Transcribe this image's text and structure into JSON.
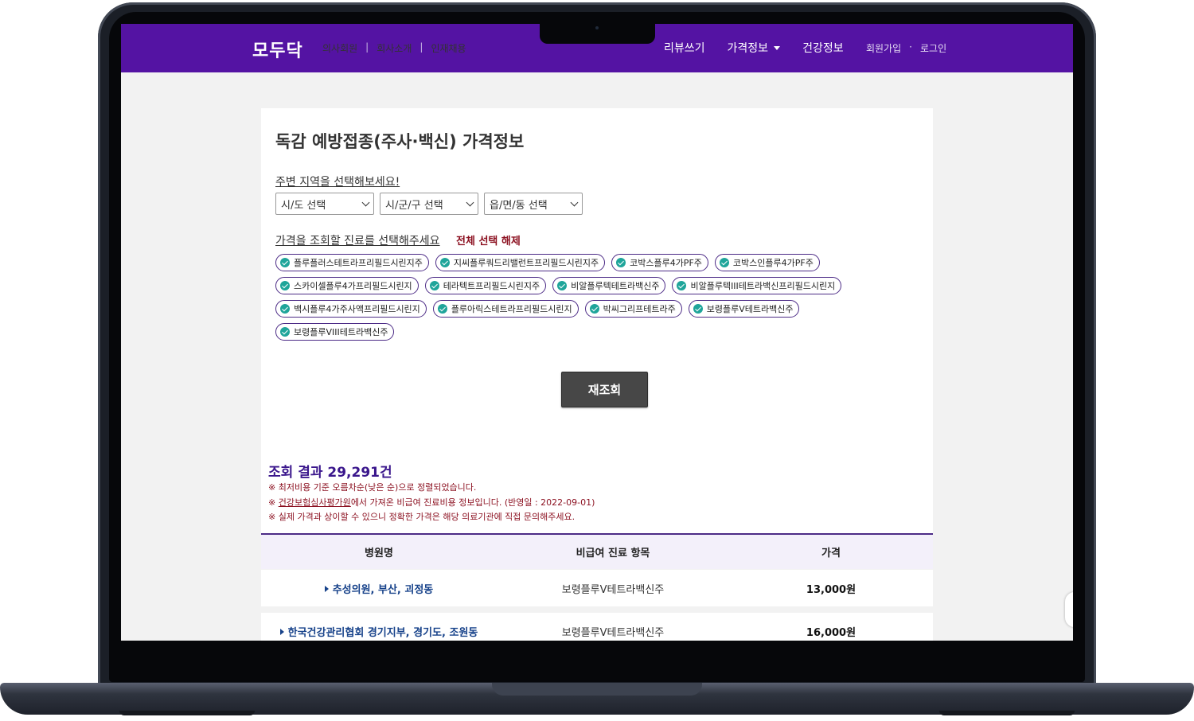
{
  "header": {
    "logo": "모두닥",
    "subnav": [
      "의사회원",
      "회사소개",
      "인재채용"
    ],
    "mainnav": {
      "review": "리뷰쓰기",
      "price_info": "가격정보",
      "health_info": "건강정보"
    },
    "auth": {
      "signup": "회원가입",
      "dot": "·",
      "login": "로그인"
    }
  },
  "page": {
    "title": "독감 예방접종(주사·백신) 가격정보",
    "region_label": "주변 지역을 선택해보세요!",
    "selects": {
      "sido": "시/도 선택",
      "sigungu": "시/군/구 선택",
      "eupmyeondong": "읍/면/동 선택"
    },
    "treatment_label": "가격을 조회할 진료를 선택해주세요",
    "clear_all": "전체 선택 해제",
    "chips": [
      "플루플러스테트라프리필드시린지주",
      "지씨플루쿼드리밸런트프리필드시린지주",
      "코박스플루4가PF주",
      "코박스인플루4가PF주",
      "스카이셀플루4가프리필드시린지",
      "테라텍트프리필드시린지주",
      "비알플루텍테트라백신주",
      "비알플루텍III테트라백신프리필드시린지",
      "백시플루4가주사액프리필드시린지",
      "플루아릭스테트라프리필드시린지",
      "박씨그리프테트라주",
      "보령플루Ⅴ테트라백신주",
      "보령플루VIII테트라백신주"
    ],
    "requery_button": "재조회",
    "result_count": "조회 결과 29,291건",
    "notes": {
      "sort": "※ 최저비용 기준 오름차순(낮은 순)으로 정렬되었습니다.",
      "source_prefix": "※ ",
      "source_link": "건강보험심사평가원",
      "source_rest": "에서 가져온 비급여 진료비용 정보입니다. (반영일 : 2022-09-01)",
      "disclaimer": "※ 실제 가격과 상이할 수 있으니 정확한 가격은 해당 의료기관에 직접 문의해주세요."
    },
    "table": {
      "headers": [
        "병원명",
        "비급여 진료 항목",
        "가격"
      ],
      "rows": [
        {
          "hospital": "추성의원, 부산, 괴정동",
          "item": "보령플루Ⅴ테트라백신주",
          "price": "13,000원"
        },
        {
          "hospital": "한국건강관리협회 경기지부, 경기도, 조원동",
          "item": "보령플루Ⅴ테트라백신주",
          "price": "16,000원"
        }
      ]
    }
  },
  "colors": {
    "header_bg": "#5413a3",
    "accent_purple": "#3a168c",
    "note_red": "#8b0f1f",
    "check_teal": "#1fa59a",
    "button_dark": "#474747",
    "hospital_blue": "#17428a"
  }
}
